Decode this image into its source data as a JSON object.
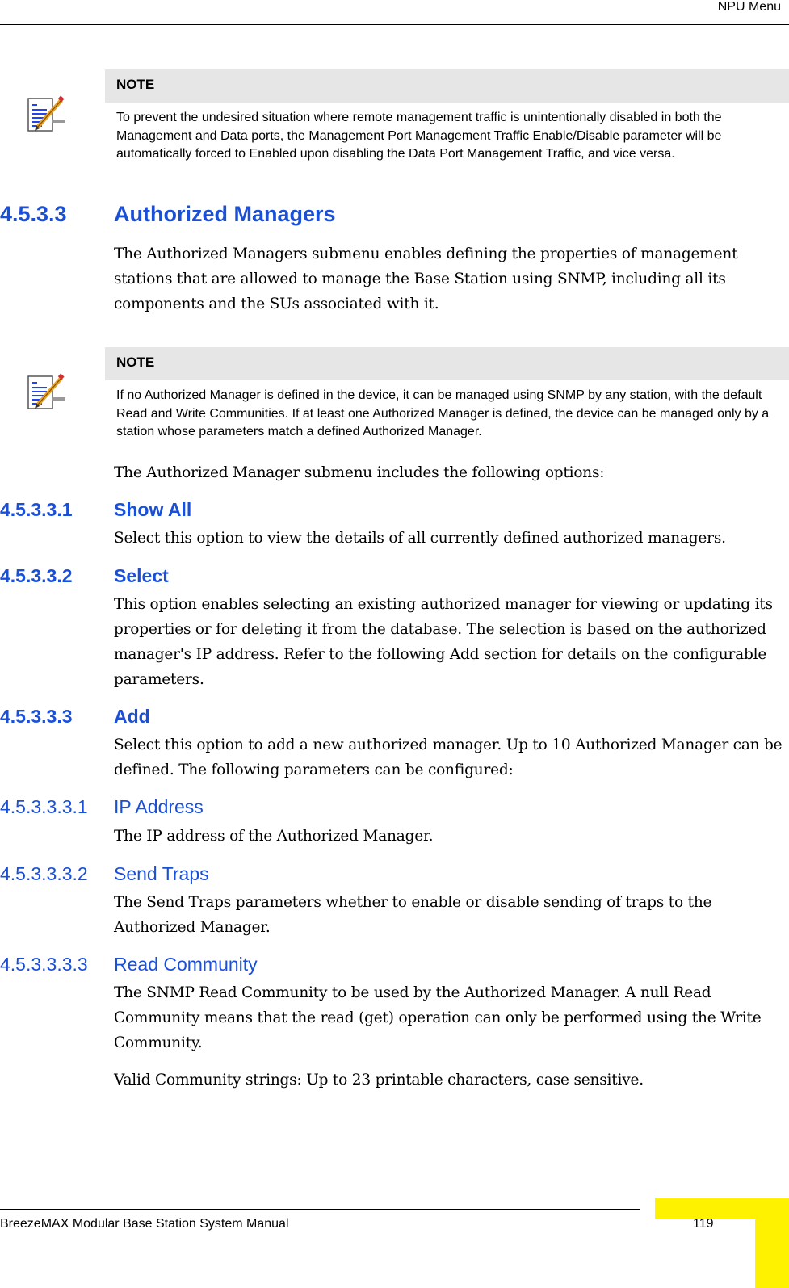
{
  "header": {
    "section": "NPU Menu"
  },
  "notes": [
    {
      "icon": "note-pencil-icon",
      "title": "NOTE",
      "body": "To prevent the undesired situation where remote management traffic is unintentionally disabled in both the Management and Data ports, the Management Port Management Traffic Enable/Disable parameter will be automatically forced to Enabled upon disabling the Data Port Management Traffic, and vice versa."
    },
    {
      "icon": "note-pencil-icon",
      "title": "NOTE",
      "body": "If no Authorized Manager is defined in the device, it can be managed using SNMP by any station, with the default Read and Write Communities. If at least one Authorized Manager is defined, the device can be managed only by a station whose parameters match a defined Authorized Manager."
    }
  ],
  "section": {
    "number": "4.5.3.3",
    "title": "Authorized Managers",
    "intro": "The Authorized Managers submenu enables defining the properties of management stations that are allowed to manage the Base Station using SNMP, including all its components and the SUs associated with it.",
    "options_intro": "The Authorized Manager submenu includes the following options:"
  },
  "subsections": [
    {
      "number": "4.5.3.3.1",
      "title": "Show All",
      "text": "Select this option to view the details of all currently defined authorized managers."
    },
    {
      "number": "4.5.3.3.2",
      "title": "Select",
      "text": "This option enables selecting an existing authorized manager for viewing or updating its properties or for deleting it from the database. The selection is based on the authorized manager's IP address. Refer to the following Add section for details on the configurable parameters."
    },
    {
      "number": "4.5.3.3.3",
      "title": "Add",
      "text": "Select this option to add a new authorized manager. Up to 10 Authorized Manager can be defined. The following parameters can be configured:"
    }
  ],
  "parameters": [
    {
      "number": "4.5.3.3.3.1",
      "title": "IP Address",
      "text": "The IP address of the Authorized Manager."
    },
    {
      "number": "4.5.3.3.3.2",
      "title": "Send Traps",
      "text": "The Send Traps parameters whether to enable or disable sending of traps to the Authorized Manager."
    },
    {
      "number": "4.5.3.3.3.3",
      "title": "Read Community",
      "text": "The SNMP Read Community to be used by the Authorized Manager. A null Read Community means that the read (get) operation can only be performed using the Write Community.",
      "text2": "Valid Community strings: Up to 23 printable characters, case sensitive."
    }
  ],
  "footer": {
    "manual": "BreezeMAX Modular Base Station System Manual",
    "page": "119"
  },
  "colors": {
    "heading": "#1a4fd8",
    "note_title_bg": "#e6e6e6",
    "page_tab": "#fff200"
  }
}
